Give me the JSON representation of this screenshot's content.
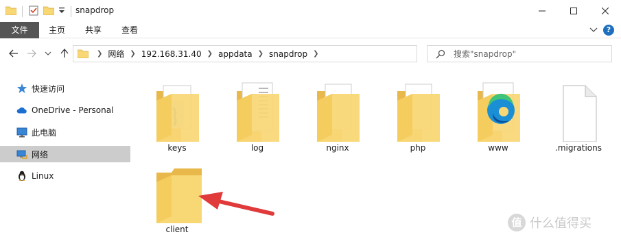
{
  "window": {
    "title": "snapdrop"
  },
  "ribbon": {
    "tabs": [
      "文件",
      "主页",
      "共享",
      "查看"
    ]
  },
  "address": {
    "crumbs": [
      "网络",
      "192.168.31.40",
      "appdata",
      "snapdrop"
    ]
  },
  "search": {
    "placeholder": "搜索\"snapdrop\""
  },
  "sidebar": {
    "items": [
      {
        "label": "快速访问",
        "icon": "star-icon"
      },
      {
        "label": "OneDrive - Personal",
        "icon": "cloud-icon"
      },
      {
        "label": "此电脑",
        "icon": "computer-icon"
      },
      {
        "label": "网络",
        "icon": "network-icon",
        "selected": true
      },
      {
        "label": "Linux",
        "icon": "linux-penguin-icon"
      }
    ]
  },
  "files": [
    {
      "name": "keys",
      "type": "folder-with-content"
    },
    {
      "name": "log",
      "type": "folder-with-content"
    },
    {
      "name": "nginx",
      "type": "folder-with-content"
    },
    {
      "name": "php",
      "type": "folder-with-content"
    },
    {
      "name": "www",
      "type": "folder-edge"
    },
    {
      "name": ".migrations",
      "type": "file"
    },
    {
      "name": "client",
      "type": "folder-empty",
      "annotated": true
    }
  ],
  "annotation": {
    "arrow_color": "#e03a3a"
  },
  "colors": {
    "file_tab_bg": "#555555",
    "folder_yellow": "#f8d775",
    "folder_dark": "#e8b84a",
    "selected_bg": "#cccccc"
  },
  "watermark": {
    "badge": "值",
    "text": "什么值得买"
  }
}
